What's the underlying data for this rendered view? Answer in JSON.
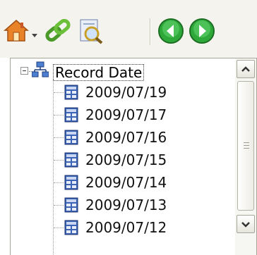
{
  "toolbar": {
    "buttons": [
      {
        "name": "home-icon",
        "tooltip": "Home"
      },
      {
        "name": "dropdown-arrow-icon"
      },
      {
        "name": "link-icon"
      },
      {
        "name": "find-icon"
      },
      {
        "name": "back-icon"
      },
      {
        "name": "forward-icon"
      }
    ]
  },
  "tree": {
    "root": {
      "label": "Record Date",
      "expanded": true,
      "icon": "hierarchy-icon"
    },
    "items": [
      {
        "label": "2009/07/19",
        "icon": "record-icon"
      },
      {
        "label": "2009/07/17",
        "icon": "record-icon"
      },
      {
        "label": "2009/07/16",
        "icon": "record-icon"
      },
      {
        "label": "2009/07/15",
        "icon": "record-icon"
      },
      {
        "label": "2009/07/14",
        "icon": "record-icon"
      },
      {
        "label": "2009/07/13",
        "icon": "record-icon"
      },
      {
        "label": "2009/07/12",
        "icon": "record-icon"
      }
    ]
  },
  "colors": {
    "home": "#e8832a",
    "link": "#4a9a2a",
    "back_forward": "#2fa83a",
    "record_icon": "#3c63b5"
  }
}
